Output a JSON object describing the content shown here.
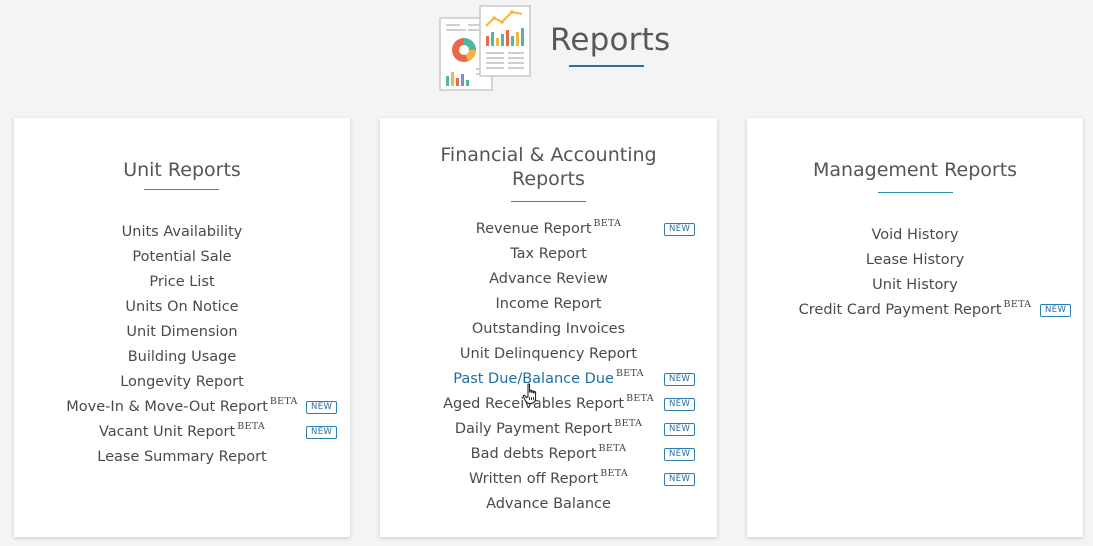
{
  "header": {
    "title": "Reports"
  },
  "cards": {
    "unit": {
      "title": "Unit Reports",
      "items": [
        {
          "label": "Units Availability"
        },
        {
          "label": "Potential Sale"
        },
        {
          "label": "Price List"
        },
        {
          "label": "Units On Notice"
        },
        {
          "label": "Unit Dimension"
        },
        {
          "label": "Building Usage"
        },
        {
          "label": "Longevity Report"
        },
        {
          "label": "Move-In & Move-Out Report",
          "beta": "BETA",
          "badge": "NEW"
        },
        {
          "label": "Vacant Unit Report",
          "beta": "BETA",
          "badge": "NEW"
        },
        {
          "label": "Lease Summary Report"
        }
      ]
    },
    "financial": {
      "title_line1": "Financial & Accounting",
      "title_line2": "Reports",
      "items": [
        {
          "label": "Revenue Report",
          "beta": "BETA",
          "badge": "NEW"
        },
        {
          "label": "Tax Report"
        },
        {
          "label": "Advance Review"
        },
        {
          "label": "Income Report"
        },
        {
          "label": "Outstanding Invoices"
        },
        {
          "label": "Unit Delinquency Report"
        },
        {
          "label": "Past Due/Balance Due",
          "beta": "BETA",
          "badge": "NEW"
        },
        {
          "label": "Aged Receivables Report",
          "beta": "BETA",
          "badge": "NEW"
        },
        {
          "label": "Daily Payment Report",
          "beta": "BETA",
          "badge": "NEW"
        },
        {
          "label": "Bad debts Report",
          "beta": "BETA",
          "badge": "NEW"
        },
        {
          "label": "Written off Report",
          "beta": "BETA",
          "badge": "NEW"
        },
        {
          "label": "Advance Balance"
        }
      ]
    },
    "management": {
      "title": "Management Reports",
      "items": [
        {
          "label": "Void History"
        },
        {
          "label": "Lease History"
        },
        {
          "label": "Unit History"
        },
        {
          "label": "Credit Card Payment Report",
          "beta": "BETA",
          "badge": "NEW"
        }
      ]
    }
  },
  "colors": {
    "accent": "#2a6fa8",
    "active_link": "#1f6ea3",
    "background": "#f4f4f4"
  },
  "icons": {
    "header": "reports-illustration-icon",
    "cursor": "hand-pointer-cursor-icon"
  }
}
